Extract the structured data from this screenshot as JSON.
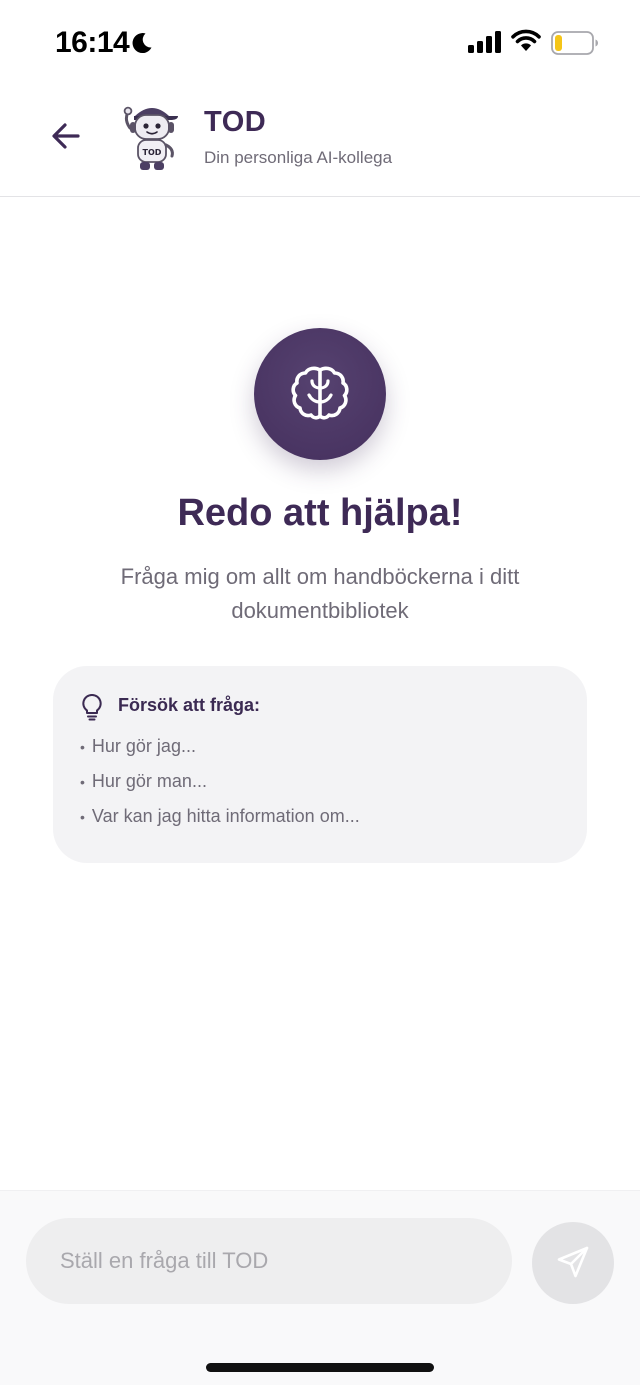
{
  "status_bar": {
    "time": "16:14",
    "battery_level": 0.2,
    "battery_color": "#f5c518"
  },
  "header": {
    "title": "TOD",
    "subtitle": "Din personliga AI-kollega",
    "avatar_badge": "TOD"
  },
  "hero": {
    "title": "Redo att hjälpa!",
    "subtitle": "Fråga mig om allt om handböckerna i ditt dokumentbibliotek",
    "icon": "brain-icon",
    "accent_color": "#4a3563"
  },
  "suggestions": {
    "title": "Försök att fråga:",
    "items": [
      "Hur gör jag...",
      "Hur gör man...",
      "Var kan jag hitta information om..."
    ]
  },
  "composer": {
    "placeholder": "Ställ en fråga till TOD",
    "value": ""
  }
}
